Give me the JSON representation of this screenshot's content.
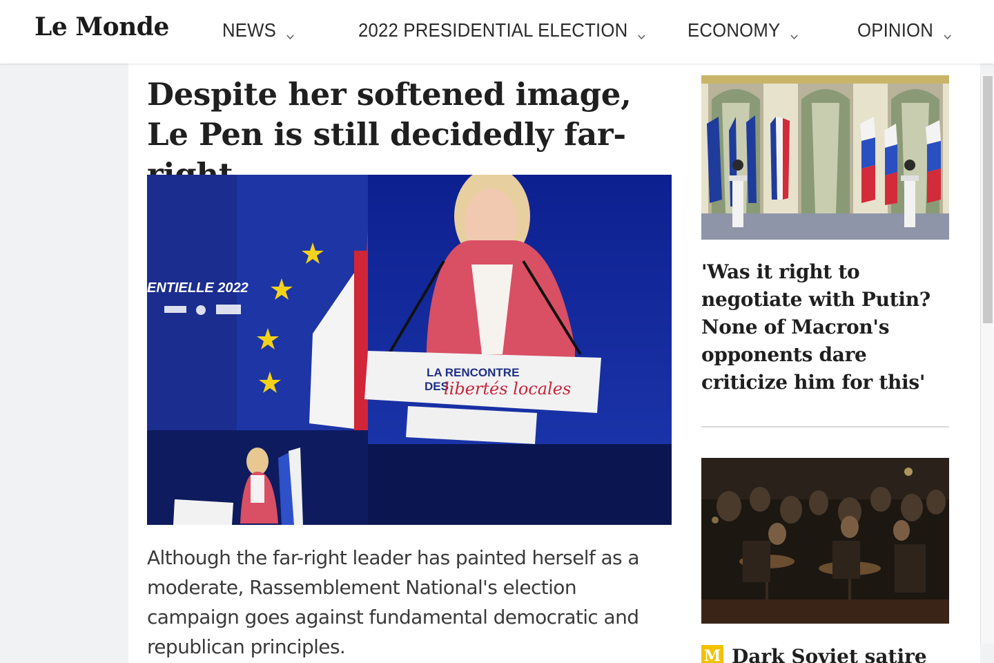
{
  "header": {
    "logo": "Le Monde",
    "nav": [
      {
        "label": "NEWS"
      },
      {
        "label": "2022 PRESIDENTIAL ELECTION"
      },
      {
        "label": "ECONOMY"
      },
      {
        "label": "OPINION"
      }
    ]
  },
  "main_article": {
    "headline": "Despite her softened image, Le Pen is still decidedly far-right",
    "image_sign_line1": "LA RENCONTRE",
    "image_sign_line2": "DES",
    "image_sign_script": "libertés locales",
    "image_banner": "ENTIELLE 2022",
    "standfirst": "Although the far-right leader has painted herself as a moderate, Rassemblement National's election campaign goes against fundamental democratic and republican principles."
  },
  "side": {
    "article1_title": "'Was it right to negotiate with Putin? None of Macron's opponents dare criticize him for this'",
    "article2_badge": "M",
    "article2_title": "Dark Soviet satire"
  },
  "colors": {
    "badge_yellow": "#f2c200",
    "hero_blue": "#0f1f6b"
  }
}
